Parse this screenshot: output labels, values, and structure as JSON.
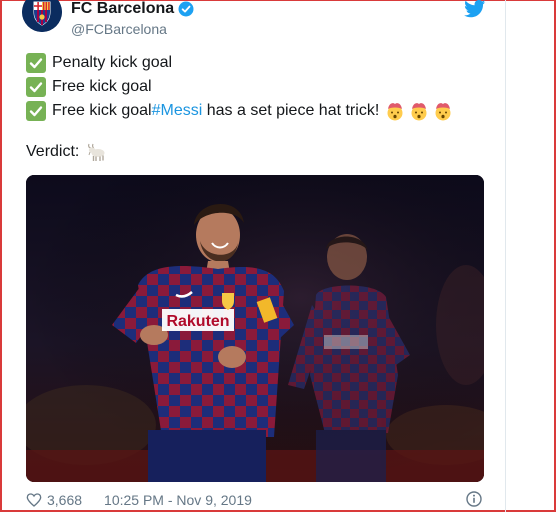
{
  "tweet": {
    "display_name": "FC Barcelona",
    "handle": "@FCBarcelona",
    "lines": [
      "Penalty kick goal",
      "Free kick goal",
      "Free kick goal"
    ],
    "hashtag": "#Messi",
    "tail_text": " has a set piece hat trick!",
    "verdict_label": "Verdict:",
    "likes": "3,668",
    "timestamp": "10:25 PM - Nov 9, 2019"
  },
  "image": {
    "jersey_sponsor": "Rakuten"
  },
  "icons": {
    "avatar": "fc-barcelona-crest-icon",
    "verified": "verified-badge-icon",
    "twitter": "twitter-bird-icon",
    "check": "check-mark-icon",
    "exploding_head": "exploding-head-emoji-icon",
    "goat": "goat-emoji-icon",
    "like": "heart-icon",
    "info": "info-icon"
  },
  "colors": {
    "link": "#1b95e0",
    "check": "#77b255",
    "muted": "#657786",
    "frame": "#d93a3a"
  }
}
